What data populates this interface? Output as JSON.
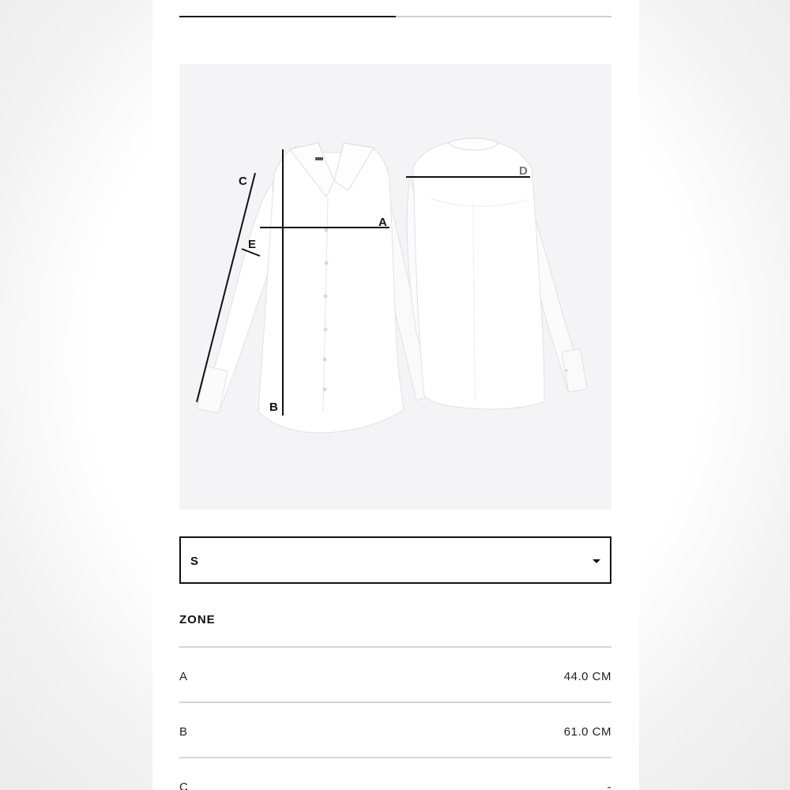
{
  "progress": {
    "value": 0.5
  },
  "product_image": {
    "icon": "shirt-measurement-diagram",
    "labels": [
      "A",
      "B",
      "C",
      "D",
      "E"
    ]
  },
  "size_selector": {
    "selected": "S",
    "icon": "chevron-down-icon"
  },
  "zone": {
    "heading": "ZONE",
    "rows": [
      {
        "key": "A",
        "value": "44.0 CM"
      },
      {
        "key": "B",
        "value": "61.0 CM"
      },
      {
        "key": "C",
        "value": "-"
      }
    ]
  },
  "colors": {
    "border": "#111111",
    "divider": "#d5d5d5",
    "image_background": "#f4f4f6"
  }
}
